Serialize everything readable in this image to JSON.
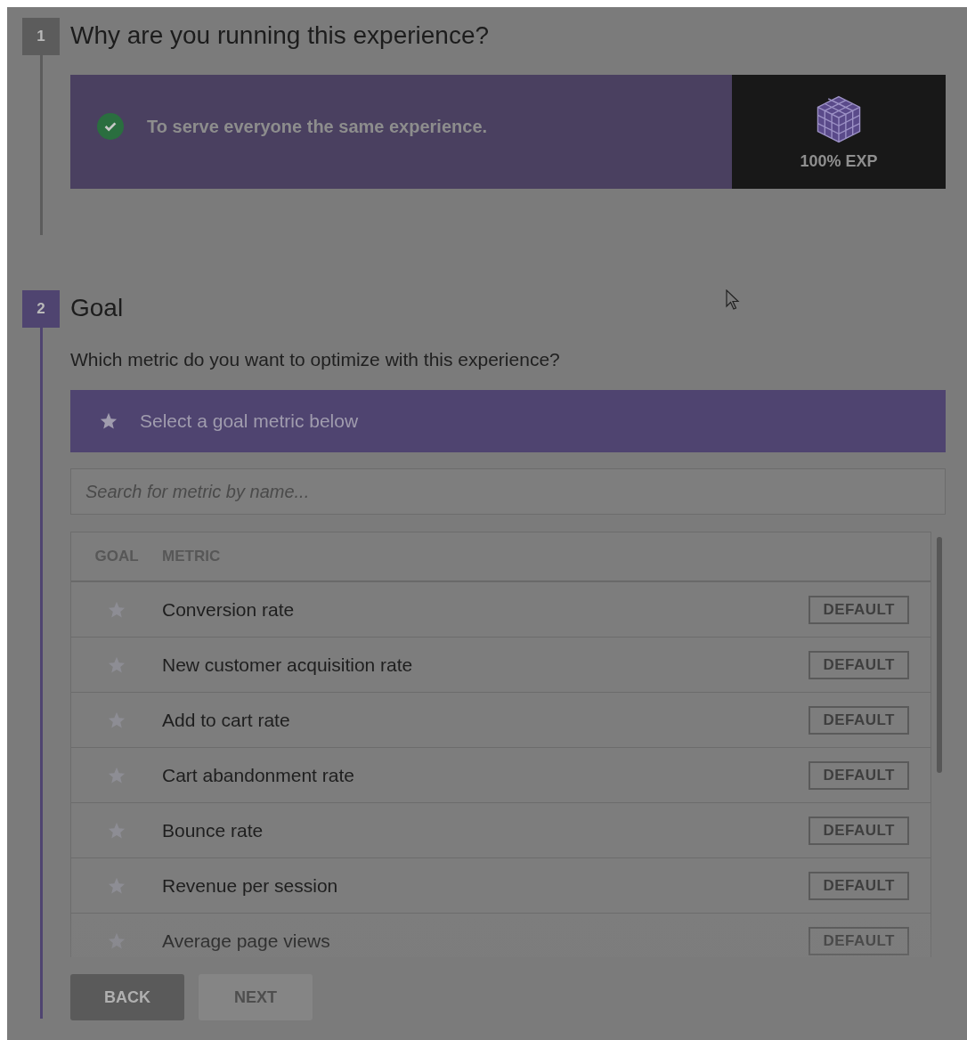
{
  "steps": [
    {
      "number": "1",
      "title": "Why are you running this experience?",
      "active": false,
      "option": {
        "text": "To serve everyone the same experience.",
        "selected": true,
        "tag": "100% EXP"
      }
    },
    {
      "number": "2",
      "title": "Goal",
      "active": true,
      "question": "Which metric do you want to optimize with this experience?",
      "banner": "Select a goal metric below",
      "search": {
        "placeholder": "Search for metric by name..."
      },
      "table": {
        "columns": [
          "GOAL",
          "METRIC"
        ],
        "rows": [
          {
            "metric": "Conversion rate",
            "badge": "DEFAULT",
            "selected": false
          },
          {
            "metric": "New customer acquisition rate",
            "badge": "DEFAULT",
            "selected": false
          },
          {
            "metric": "Add to cart rate",
            "badge": "DEFAULT",
            "selected": false
          },
          {
            "metric": "Cart abandonment rate",
            "badge": "DEFAULT",
            "selected": false
          },
          {
            "metric": "Bounce rate",
            "badge": "DEFAULT",
            "selected": false
          },
          {
            "metric": "Revenue per session",
            "badge": "DEFAULT",
            "selected": false
          },
          {
            "metric": "Average page views",
            "badge": "DEFAULT",
            "selected": false
          }
        ]
      }
    }
  ],
  "buttons": [
    {
      "label": "BACK",
      "disabled": false
    },
    {
      "label": "NEXT",
      "disabled": true
    }
  ]
}
